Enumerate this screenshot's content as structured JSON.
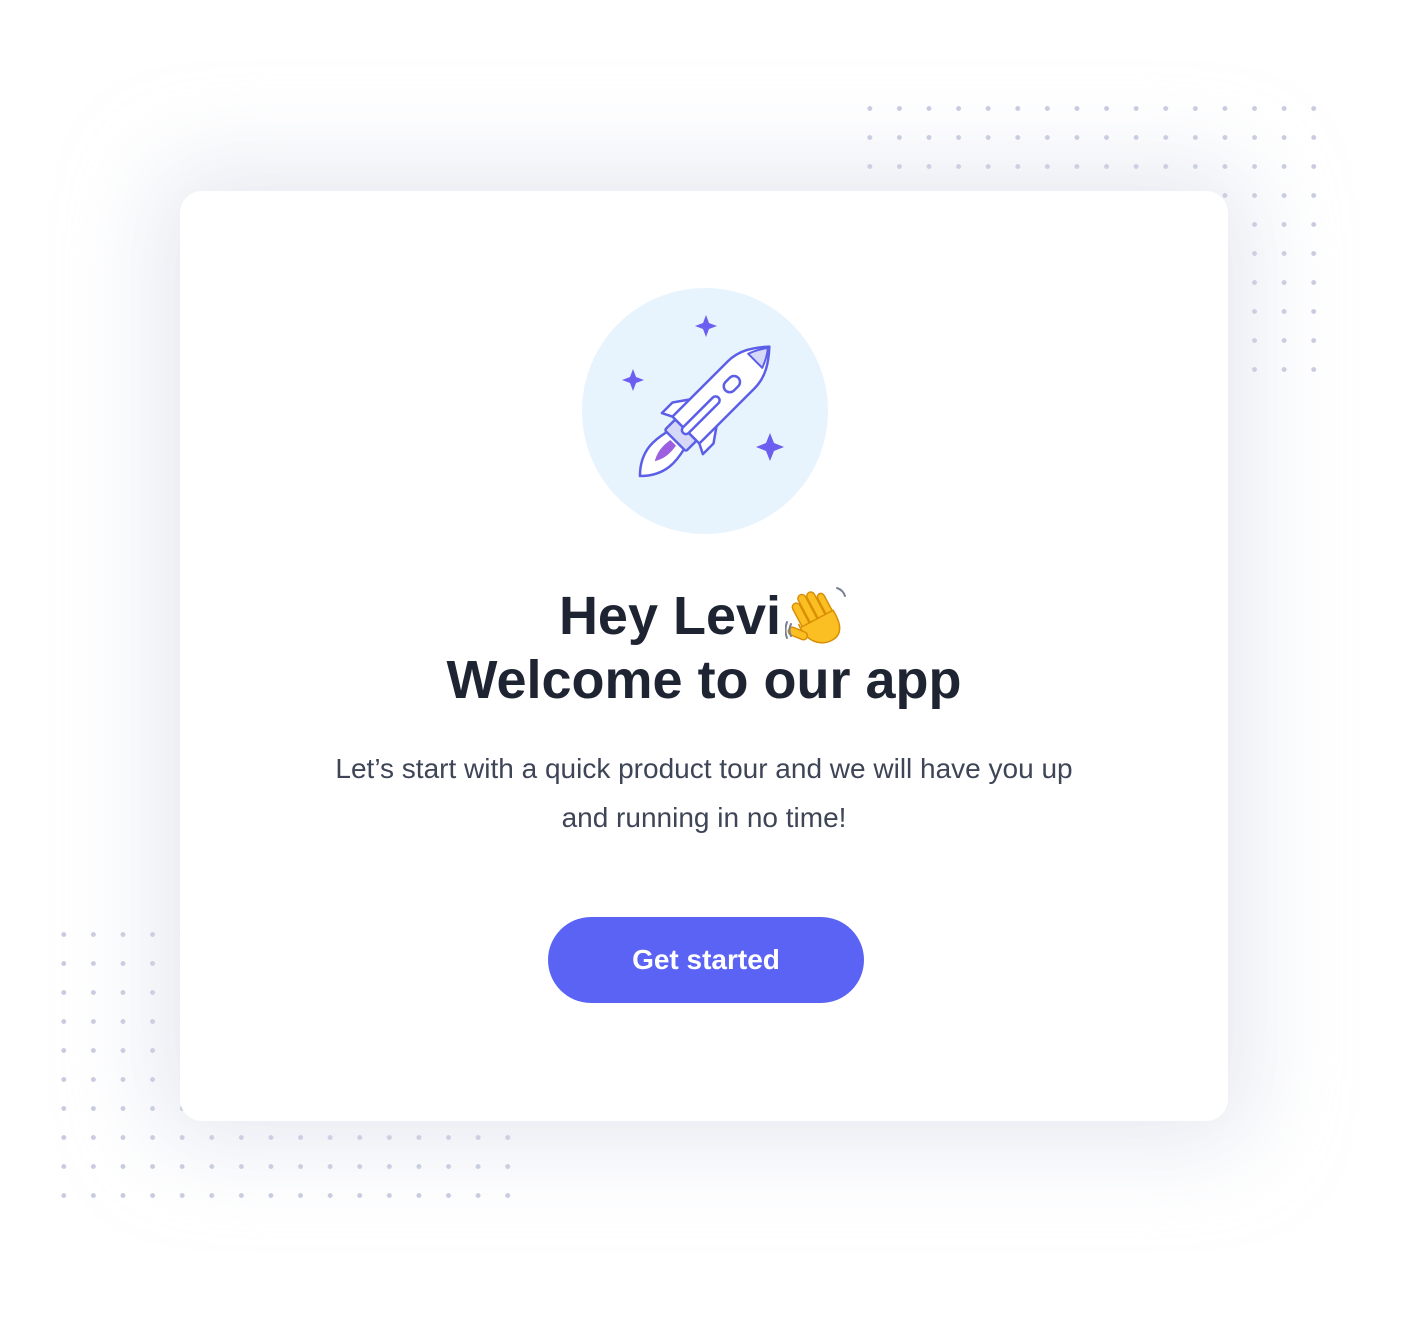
{
  "welcome_modal": {
    "greeting": "Hey Levi",
    "greeting_icon": "waving-hand-icon",
    "title": "Welcome to our app",
    "description": "Let’s start with a quick product tour and we will have you up and running in no time!",
    "illustration": "rocket-icon",
    "cta_label": "Get started"
  },
  "colors": {
    "accent": "#5b63f5",
    "heading": "#1f2433",
    "body_text": "#3e4557",
    "illustration_bg": "#e8f4fd",
    "dots": "#c9cbe0"
  }
}
